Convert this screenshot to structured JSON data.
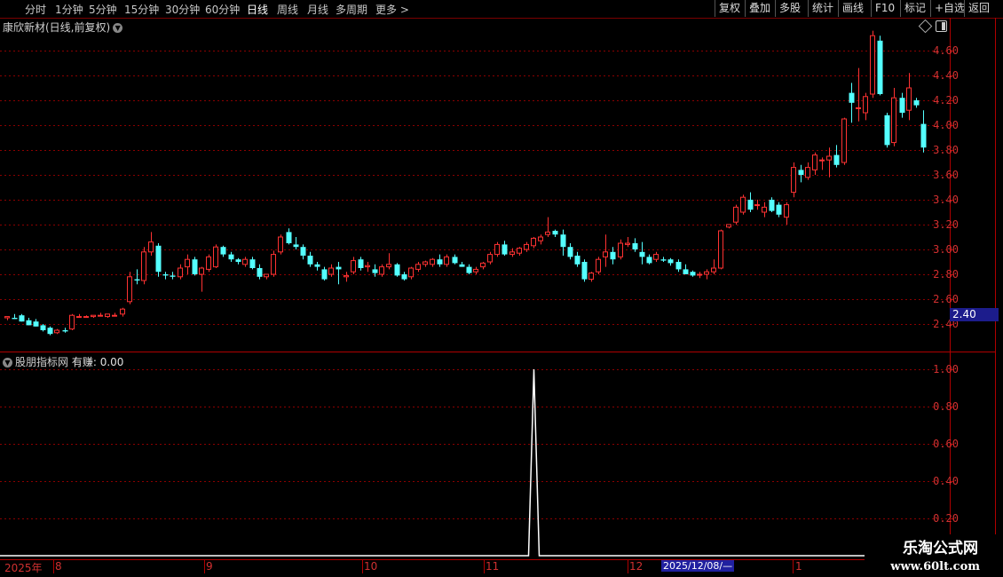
{
  "toolbar": {
    "periods": [
      "分时",
      "1分钟",
      "5分钟",
      "15分钟",
      "30分钟",
      "60分钟",
      "日线",
      "周线",
      "月线",
      "多周期",
      "更多 >"
    ],
    "active_period": "日线",
    "right_buttons": [
      "复权",
      "叠加",
      "多股",
      "统计",
      "画线",
      "F10",
      "标记",
      "+自选",
      "返回"
    ]
  },
  "stock": {
    "title": "康欣新材(日线,前复权)"
  },
  "indicator": {
    "label": "股朋指标网",
    "value_label": "有赚: 0.00"
  },
  "price_axis": [
    "4.60",
    "4.40",
    "4.20",
    "4.00",
    "3.80",
    "3.60",
    "3.40",
    "3.20",
    "3.00",
    "2.80",
    "2.60",
    "2.40"
  ],
  "current_price_tag": "2.40",
  "indicator_axis": [
    "1.00",
    "0.80",
    "0.60",
    "0.40",
    "0.20"
  ],
  "time_axis": [
    "2025年",
    "8",
    "9",
    "10",
    "11",
    "12",
    "1"
  ],
  "cursor_date": "2025/12/08/—",
  "watermark": {
    "line1": "乐淘公式网",
    "line2": "www.60lt.com"
  },
  "colors": {
    "up": "#ff3232",
    "down": "#54ffff",
    "grid": "#8b0000",
    "signal": "#ffffff"
  },
  "chart_data": [
    {
      "type": "candlestick",
      "title": "康欣新材(日线,前复权)",
      "ylim": [
        2.25,
        4.75
      ],
      "candles": [
        [
          2.45,
          2.46,
          2.43,
          2.46
        ],
        [
          2.45,
          2.48,
          2.44,
          2.44
        ],
        [
          2.47,
          2.48,
          2.42,
          2.42
        ],
        [
          2.43,
          2.45,
          2.39,
          2.39
        ],
        [
          2.42,
          2.44,
          2.38,
          2.38
        ],
        [
          2.39,
          2.4,
          2.34,
          2.35
        ],
        [
          2.37,
          2.38,
          2.31,
          2.32
        ],
        [
          2.33,
          2.36,
          2.32,
          2.35
        ],
        [
          2.35,
          2.37,
          2.33,
          2.34
        ],
        [
          2.36,
          2.48,
          2.35,
          2.47
        ],
        [
          2.46,
          2.48,
          2.45,
          2.46
        ],
        [
          2.46,
          2.47,
          2.45,
          2.46
        ],
        [
          2.46,
          2.47,
          2.45,
          2.47
        ],
        [
          2.47,
          2.49,
          2.46,
          2.47
        ],
        [
          2.46,
          2.48,
          2.45,
          2.48
        ],
        [
          2.47,
          2.49,
          2.46,
          2.47
        ],
        [
          2.48,
          2.53,
          2.46,
          2.52
        ],
        [
          2.58,
          2.82,
          2.56,
          2.78
        ],
        [
          2.76,
          2.84,
          2.72,
          2.75
        ],
        [
          2.75,
          3.02,
          2.72,
          2.98
        ],
        [
          2.98,
          3.14,
          2.95,
          3.06
        ],
        [
          3.03,
          3.05,
          2.78,
          2.82
        ],
        [
          2.8,
          2.82,
          2.76,
          2.79
        ],
        [
          2.79,
          2.82,
          2.76,
          2.78
        ],
        [
          2.78,
          2.88,
          2.76,
          2.85
        ],
        [
          2.86,
          2.96,
          2.8,
          2.92
        ],
        [
          2.92,
          2.94,
          2.79,
          2.8
        ],
        [
          2.8,
          2.86,
          2.66,
          2.85
        ],
        [
          2.84,
          2.96,
          2.82,
          2.94
        ],
        [
          2.86,
          3.04,
          2.85,
          3.02
        ],
        [
          3.02,
          3.03,
          2.94,
          2.96
        ],
        [
          2.96,
          2.98,
          2.9,
          2.92
        ],
        [
          2.92,
          2.93,
          2.88,
          2.9
        ],
        [
          2.88,
          2.94,
          2.86,
          2.92
        ],
        [
          2.92,
          2.94,
          2.84,
          2.85
        ],
        [
          2.85,
          2.88,
          2.76,
          2.78
        ],
        [
          2.78,
          2.8,
          2.76,
          2.8
        ],
        [
          2.8,
          2.99,
          2.78,
          2.96
        ],
        [
          2.98,
          3.12,
          2.96,
          3.1
        ],
        [
          3.14,
          3.17,
          3.04,
          3.05
        ],
        [
          3.04,
          3.1,
          3.0,
          3.02
        ],
        [
          3.02,
          3.04,
          2.92,
          2.95
        ],
        [
          2.95,
          2.98,
          2.86,
          2.88
        ],
        [
          2.88,
          2.9,
          2.83,
          2.86
        ],
        [
          2.84,
          2.86,
          2.75,
          2.76
        ],
        [
          2.8,
          2.88,
          2.78,
          2.85
        ],
        [
          2.86,
          2.9,
          2.72,
          2.84
        ],
        [
          2.78,
          2.82,
          2.74,
          2.79
        ],
        [
          2.82,
          2.94,
          2.8,
          2.91
        ],
        [
          2.92,
          2.94,
          2.83,
          2.85
        ],
        [
          2.86,
          2.9,
          2.82,
          2.87
        ],
        [
          2.84,
          2.88,
          2.78,
          2.81
        ],
        [
          2.8,
          2.88,
          2.78,
          2.86
        ],
        [
          2.86,
          2.97,
          2.84,
          2.88
        ],
        [
          2.88,
          2.89,
          2.78,
          2.79
        ],
        [
          2.8,
          2.82,
          2.75,
          2.76
        ],
        [
          2.78,
          2.86,
          2.76,
          2.85
        ],
        [
          2.84,
          2.9,
          2.82,
          2.88
        ],
        [
          2.88,
          2.91,
          2.86,
          2.9
        ],
        [
          2.88,
          2.93,
          2.86,
          2.92
        ],
        [
          2.92,
          2.96,
          2.86,
          2.88
        ],
        [
          2.88,
          2.96,
          2.86,
          2.94
        ],
        [
          2.94,
          2.96,
          2.88,
          2.89
        ],
        [
          2.88,
          2.9,
          2.86,
          2.86
        ],
        [
          2.86,
          2.88,
          2.8,
          2.81
        ],
        [
          2.82,
          2.86,
          2.8,
          2.84
        ],
        [
          2.86,
          2.9,
          2.84,
          2.89
        ],
        [
          2.9,
          2.98,
          2.88,
          2.96
        ],
        [
          2.96,
          3.06,
          2.94,
          3.04
        ],
        [
          3.04,
          3.07,
          2.95,
          2.96
        ],
        [
          2.96,
          3.01,
          2.94,
          2.98
        ],
        [
          2.97,
          3.02,
          2.95,
          3.01
        ],
        [
          3.0,
          3.06,
          2.98,
          3.04
        ],
        [
          3.03,
          3.1,
          3.01,
          3.09
        ],
        [
          3.07,
          3.12,
          3.04,
          3.1
        ],
        [
          3.12,
          3.26,
          3.1,
          3.14
        ],
        [
          3.15,
          3.16,
          3.1,
          3.12
        ],
        [
          3.12,
          3.16,
          2.95,
          3.02
        ],
        [
          3.02,
          3.05,
          2.92,
          2.94
        ],
        [
          2.95,
          2.98,
          2.86,
          2.88
        ],
        [
          2.9,
          2.92,
          2.74,
          2.76
        ],
        [
          2.76,
          2.82,
          2.74,
          2.81
        ],
        [
          2.82,
          2.94,
          2.8,
          2.92
        ],
        [
          2.94,
          3.12,
          2.86,
          2.98
        ],
        [
          2.98,
          3.02,
          2.88,
          2.92
        ],
        [
          2.94,
          3.08,
          2.92,
          3.05
        ],
        [
          3.04,
          3.1,
          3.02,
          3.05
        ],
        [
          3.05,
          3.09,
          2.98,
          3.0
        ],
        [
          2.98,
          3.06,
          2.88,
          2.94
        ],
        [
          2.94,
          2.96,
          2.88,
          2.89
        ],
        [
          2.92,
          2.98,
          2.9,
          2.96
        ],
        [
          2.92,
          2.94,
          2.9,
          2.91
        ],
        [
          2.92,
          2.93,
          2.87,
          2.89
        ],
        [
          2.9,
          2.92,
          2.82,
          2.84
        ],
        [
          2.84,
          2.88,
          2.8,
          2.8
        ],
        [
          2.82,
          2.83,
          2.78,
          2.79
        ],
        [
          2.8,
          2.82,
          2.77,
          2.8
        ],
        [
          2.8,
          2.84,
          2.76,
          2.82
        ],
        [
          2.82,
          2.92,
          2.8,
          2.85
        ],
        [
          2.85,
          3.16,
          2.84,
          3.15
        ],
        [
          3.18,
          3.2,
          3.17,
          3.2
        ],
        [
          3.22,
          3.36,
          3.2,
          3.34
        ],
        [
          3.3,
          3.44,
          3.28,
          3.42
        ],
        [
          3.4,
          3.46,
          3.3,
          3.32
        ],
        [
          3.36,
          3.4,
          3.32,
          3.36
        ],
        [
          3.3,
          3.38,
          3.26,
          3.34
        ],
        [
          3.4,
          3.42,
          3.3,
          3.31
        ],
        [
          3.36,
          3.38,
          3.26,
          3.28
        ],
        [
          3.26,
          3.38,
          3.2,
          3.36
        ],
        [
          3.46,
          3.7,
          3.42,
          3.66
        ],
        [
          3.64,
          3.68,
          3.54,
          3.6
        ],
        [
          3.58,
          3.7,
          3.56,
          3.66
        ],
        [
          3.64,
          3.78,
          3.6,
          3.76
        ],
        [
          3.72,
          3.74,
          3.64,
          3.72
        ],
        [
          3.72,
          3.82,
          3.58,
          3.75
        ],
        [
          3.76,
          3.84,
          3.66,
          3.68
        ],
        [
          3.7,
          4.06,
          3.68,
          4.05
        ],
        [
          4.26,
          4.34,
          4.02,
          4.18
        ],
        [
          4.14,
          4.46,
          4.03,
          4.14
        ],
        [
          4.1,
          4.26,
          4.04,
          4.23
        ],
        [
          4.25,
          4.76,
          4.22,
          4.72
        ],
        [
          4.68,
          4.72,
          4.24,
          4.25
        ],
        [
          4.08,
          4.1,
          3.82,
          3.84
        ],
        [
          3.86,
          4.3,
          3.83,
          4.22
        ],
        [
          4.22,
          4.26,
          4.06,
          4.1
        ],
        [
          4.12,
          4.42,
          4.04,
          4.3
        ],
        [
          4.2,
          4.22,
          4.14,
          4.16
        ],
        [
          4.01,
          4.12,
          3.78,
          3.82
        ]
      ]
    },
    {
      "type": "line",
      "series": [
        {
          "name": "有赚",
          "spikes": [
            {
              "index": 73,
              "value": 1.0
            }
          ]
        }
      ],
      "ylim": [
        0,
        1.08
      ]
    }
  ]
}
